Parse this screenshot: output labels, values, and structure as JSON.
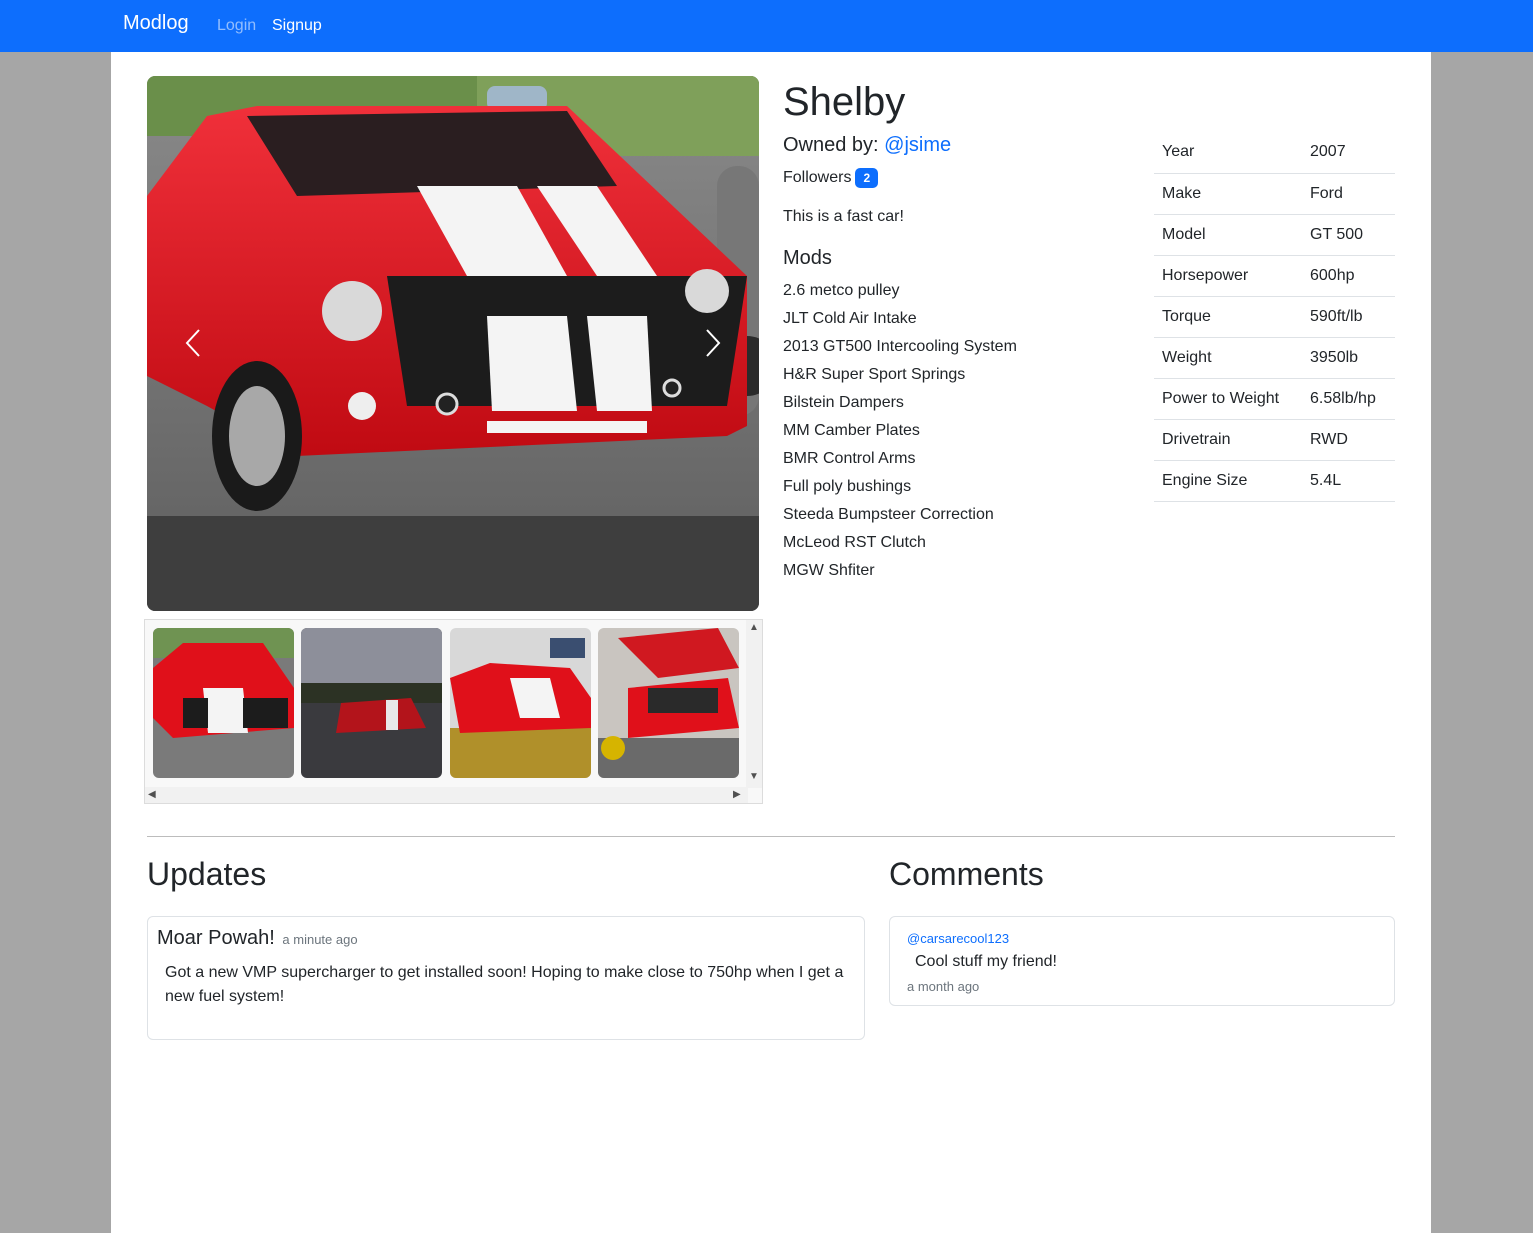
{
  "nav": {
    "brand": "Modlog",
    "login": "Login",
    "signup": "Signup"
  },
  "car": {
    "title": "Shelby",
    "owned_label": "Owned by:",
    "owner": "@jsime",
    "followers_label": "Followers",
    "followers_count": "2",
    "description": "This is a fast car!",
    "mods_heading": "Mods",
    "mods": [
      "2.6 metco pulley",
      "JLT Cold Air Intake",
      "2013 GT500 Intercooling System",
      "H&R Super Sport Springs",
      "Bilstein Dampers",
      "MM Camber Plates",
      "BMR Control Arms",
      "Full poly bushings",
      "Steeda Bumpsteer Correction",
      "McLeod RST Clutch",
      "MGW Shfiter"
    ],
    "specs": [
      {
        "label": "Year",
        "value": "2007"
      },
      {
        "label": "Make",
        "value": "Ford"
      },
      {
        "label": "Model",
        "value": "GT 500"
      },
      {
        "label": "Horsepower",
        "value": "600hp"
      },
      {
        "label": "Torque",
        "value": "590ft/lb"
      },
      {
        "label": "Weight",
        "value": "3950lb"
      },
      {
        "label": "Power to Weight",
        "value": "6.58lb/hp"
      },
      {
        "label": "Drivetrain",
        "value": "RWD"
      },
      {
        "label": "Engine Size",
        "value": "5.4L"
      }
    ]
  },
  "updates": {
    "heading": "Updates",
    "items": [
      {
        "title": "Moar Powah!",
        "time": "a minute ago",
        "body": "Got a new VMP supercharger to get installed soon! Hoping to make close to 750hp when I get a new fuel system!"
      }
    ]
  },
  "comments": {
    "heading": "Comments",
    "items": [
      {
        "user": "@carsarecool123",
        "body": "Cool stuff my friend!",
        "time": "a month ago"
      }
    ]
  },
  "colors": {
    "primary": "#0d6efd",
    "car_red": "#e0101a",
    "stripe": "#f4f4f4",
    "backdrop": "#a6a6a6"
  }
}
